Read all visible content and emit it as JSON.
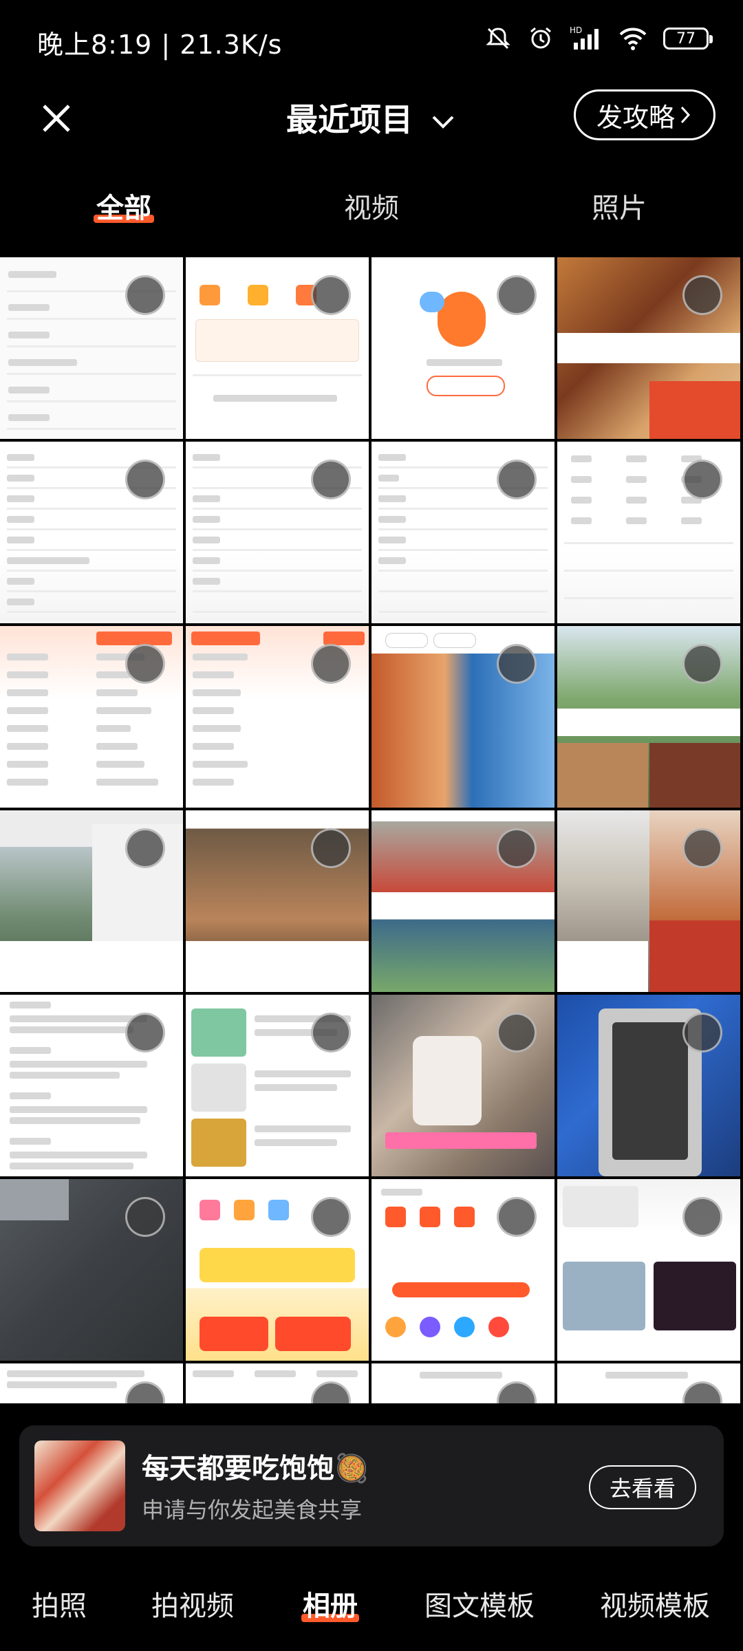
{
  "status": {
    "time": "晚上8:19 | 21.3K/s",
    "battery": "77",
    "icons": [
      "mute-icon",
      "alarm-icon",
      "hd-signal-icon",
      "wifi-icon",
      "battery-icon"
    ]
  },
  "header": {
    "title": "最近项目",
    "publish": "发攻略"
  },
  "tabs": [
    "全部",
    "视频",
    "照片"
  ],
  "active_tab": "全部",
  "grid": {
    "columns": 4,
    "items": [
      "settings-menu",
      "order-status",
      "login-prompt",
      "food-collage",
      "city-index",
      "county-index",
      "district-index",
      "province-index",
      "hot-spots",
      "travel-rank",
      "food-search",
      "park-photos",
      "park-notes",
      "old-street",
      "photo-notes",
      "cafe-notes",
      "privacy-settings",
      "shopping-list",
      "phone-hands",
      "phone-repair",
      "floor-video",
      "promo-page",
      "service-page",
      "laptop-list"
    ]
  },
  "promo_card": {
    "title": "每天都要吃饱饱🥘",
    "subtitle": "申请与你发起美食共享",
    "button": "去看看"
  },
  "bottom_nav": [
    "拍照",
    "拍视频",
    "相册",
    "图文模板",
    "视频模板"
  ],
  "active_nav": "相册",
  "colors": {
    "accent": "#ff5a2b",
    "background": "#000000",
    "card": "#1c1c1e"
  }
}
